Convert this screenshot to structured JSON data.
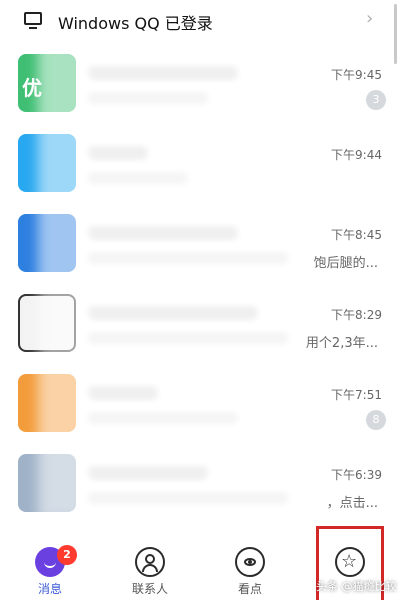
{
  "banner": {
    "text": "Windows QQ 已登录",
    "chevron": "›",
    "icon": "monitor-icon"
  },
  "chats": [
    {
      "time": "下午9:45",
      "preview": "",
      "unread": "3",
      "avatar_color": "#3fbf73",
      "avatar_glyph": "优"
    },
    {
      "time": "下午9:44",
      "preview": "",
      "unread": "",
      "avatar_color": "#28a8f0",
      "avatar_glyph": ""
    },
    {
      "time": "下午8:45",
      "preview": "饱后腿的...",
      "unread": "",
      "avatar_color": "#2d7fe0",
      "avatar_glyph": ""
    },
    {
      "time": "下午8:29",
      "preview": "用个2,3年...",
      "unread": "",
      "avatar_color": "#f3f3f3",
      "avatar_glyph": ""
    },
    {
      "time": "下午7:51",
      "preview": "",
      "unread": "8",
      "avatar_color": "#f39c3b",
      "avatar_glyph": ""
    },
    {
      "time": "下午6:39",
      "preview": "，点击...",
      "unread": "",
      "avatar_color": "#9fb2c7",
      "avatar_glyph": ""
    }
  ],
  "nav": {
    "messages": {
      "label": "消息",
      "badge": "2",
      "icon": "messages-icon"
    },
    "contacts": {
      "label": "联系人",
      "icon": "contacts-icon"
    },
    "watch": {
      "label": "看点",
      "icon": "eye-icon"
    },
    "explore": {
      "icon": "star-icon"
    }
  },
  "watermark": "头条 @猫瘾比较",
  "colors": {
    "accent": "#3d5bd6",
    "badge_red": "#ff3b30",
    "highlight_red": "#d32828"
  }
}
